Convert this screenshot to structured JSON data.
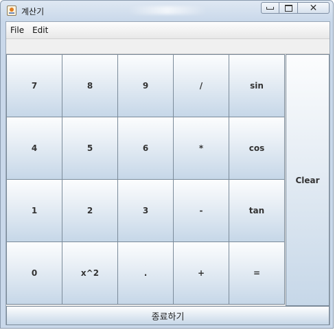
{
  "window": {
    "title": "계산기",
    "controls": {
      "minimize": "minimize",
      "maximize": "maximize",
      "close": "✕"
    }
  },
  "menu": [
    "File",
    "Edit"
  ],
  "display": {
    "value": ""
  },
  "keypad": [
    [
      "7",
      "8",
      "9",
      "/",
      "sin"
    ],
    [
      "4",
      "5",
      "6",
      "*",
      "cos"
    ],
    [
      "1",
      "2",
      "3",
      "-",
      "tan"
    ],
    [
      "0",
      "x^2",
      ".",
      "+",
      "="
    ]
  ],
  "clear_label": "Clear",
  "exit_label": "종료하기",
  "colors": {
    "button_top": "#fcfdfe",
    "button_bottom": "#c6d7e8",
    "button_border": "#7a8a99",
    "window_frame": "#c9d8ea"
  }
}
